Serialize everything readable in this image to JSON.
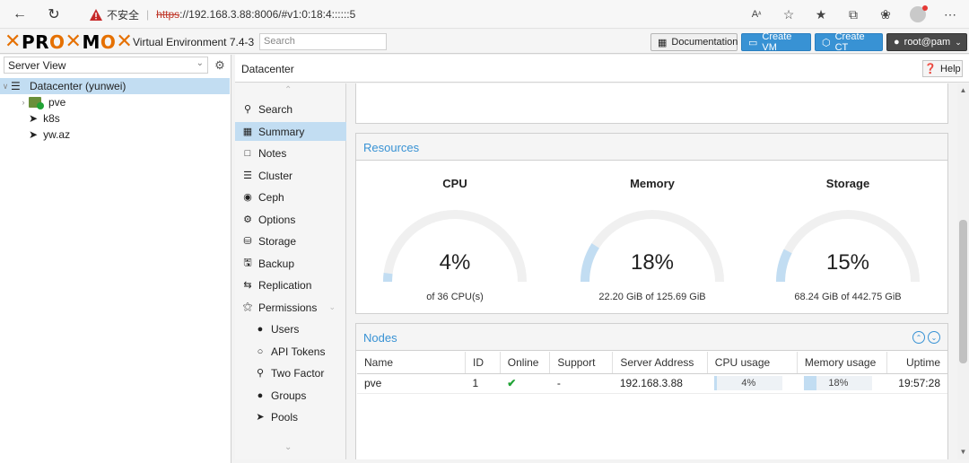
{
  "browser": {
    "insecure_label": "不安全",
    "url_proto": "https",
    "url_rest": "://192.168.3.88:8006/#v1:0:18:4::::::5"
  },
  "header": {
    "logo_text": "PROXMOX",
    "version": "Virtual Environment 7.4-3",
    "search_placeholder": "Search",
    "documentation": "Documentation",
    "create_vm": "Create VM",
    "create_ct": "Create CT",
    "user": "root@pam"
  },
  "tree": {
    "view": "Server View",
    "items": [
      {
        "label": "Datacenter (yunwei)",
        "icon": "server-rack-icon"
      },
      {
        "label": "pve",
        "icon": "node-online-icon"
      },
      {
        "label": "k8s",
        "icon": "tag-icon"
      },
      {
        "label": "yw.az",
        "icon": "tag-icon"
      }
    ]
  },
  "content": {
    "title": "Datacenter",
    "help": "Help"
  },
  "nav": {
    "items": [
      {
        "label": "Search",
        "icon": "search-icon"
      },
      {
        "label": "Summary",
        "icon": "book-icon"
      },
      {
        "label": "Notes",
        "icon": "notes-icon"
      },
      {
        "label": "Cluster",
        "icon": "cluster-icon"
      },
      {
        "label": "Ceph",
        "icon": "ceph-icon"
      },
      {
        "label": "Options",
        "icon": "gear-icon"
      },
      {
        "label": "Storage",
        "icon": "database-icon"
      },
      {
        "label": "Backup",
        "icon": "floppy-icon"
      },
      {
        "label": "Replication",
        "icon": "retweet-icon"
      },
      {
        "label": "Permissions",
        "icon": "unlock-icon"
      },
      {
        "label": "Users",
        "icon": "user-icon"
      },
      {
        "label": "API Tokens",
        "icon": "user-outline-icon"
      },
      {
        "label": "Two Factor",
        "icon": "key-icon"
      },
      {
        "label": "Groups",
        "icon": "users-icon"
      },
      {
        "label": "Pools",
        "icon": "tags-icon"
      }
    ]
  },
  "resources": {
    "title": "Resources",
    "cpu": {
      "title": "CPU",
      "value": "4%",
      "sub": "of 36 CPU(s)",
      "fraction": 0.04
    },
    "memory": {
      "title": "Memory",
      "value": "18%",
      "sub": "22.20 GiB of 125.69 GiB",
      "fraction": 0.18
    },
    "storage": {
      "title": "Storage",
      "value": "15%",
      "sub": "68.24 GiB of 442.75 GiB",
      "fraction": 0.15
    }
  },
  "nodes": {
    "title": "Nodes",
    "columns": [
      "Name",
      "ID",
      "Online",
      "Support",
      "Server Address",
      "CPU usage",
      "Memory usage",
      "Uptime"
    ],
    "rows": [
      {
        "name": "pve",
        "id": "1",
        "online": "✔",
        "support": "-",
        "address": "192.168.3.88",
        "cpu": "4%",
        "cpu_fraction": 0.04,
        "mem": "18%",
        "mem_fraction": 0.18,
        "uptime": "19:57:28"
      }
    ]
  },
  "colors": {
    "accent": "#3892d4",
    "gauge_track": "#f0f0f0",
    "gauge_fill": "#c2ddf2",
    "selected": "#c2ddf2"
  }
}
